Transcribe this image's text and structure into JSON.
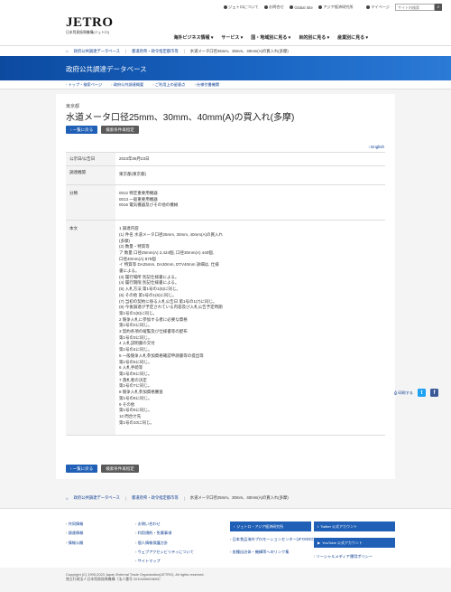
{
  "utility": {
    "about": "ジェトロについて",
    "contact": "お問合せ",
    "global": "Global Site",
    "ide": "アジア経済研究所",
    "mypage": "マイページ",
    "search_placeholder": "サイト内検索"
  },
  "logo": {
    "main": "JETRO",
    "sub": "日本貿易振興機構(ジェトロ)"
  },
  "gnav": [
    "海外ビジネス情報 ▾",
    "サービス ▾",
    "国・地域別に見る ▾",
    "目的別に見る ▾",
    "産業別に見る ▾"
  ],
  "breadcrumb": [
    "政府公共調達データベース",
    "都道府県・政令指定都市等",
    "水道メータ口径25mm、30mm、40mm(A)の買入れ(多摩)"
  ],
  "banner": {
    "title": "政府公共調達データベース"
  },
  "subnav": [
    "トップ・検索ページ",
    "政府公共調達概要",
    "ご利用上の留意点",
    "仕様付書機関"
  ],
  "main": {
    "prefecture": "東京都",
    "title": "水道メータ口径25mm、30mm、40mm(A)の買入れ(多摩)",
    "back_label": "一覧に戻る",
    "search_again_label": "検索条件再指定",
    "english_label": "English",
    "rows": [
      {
        "label": "公示日/公告日",
        "value": [
          "2023年08月23日"
        ]
      },
      {
        "label": "調達機関",
        "value": [
          "東京都(東京都)"
        ]
      },
      {
        "label": "分類",
        "value": [
          "0012 特定重要用機器",
          "0013 一般重要用機器",
          "0016 電気機器及びその他の機械"
        ]
      },
      {
        "label": "本文",
        "value": [
          "1 調達内容",
          "(1) 件名 水道メータ口径25mm, 30mm, 40mm(A)の買入れ",
          "(多摩)",
          "(2) 数量・特質等",
          "ア 数量 口径25mm(A) 2,424個, 口径30mm(A) 440個,",
          "口径40mm(A) 875個",
          "イ 特質等 DA25mm, DA30mm, DTV40mm 詳細は, 仕様",
          "書による。",
          "(3) 履行場所 別記仕様書による。",
          "(4) 履行期限 別記仕様書による。",
          "(5) 入札方法 第1号の1(5)に同じ。",
          "(6) その他 第1号の1(6)に同じ。",
          "(7) 当初の契約に係る入札公告日 第1号の1(7)に同じ。",
          "(8) 今後調達が予定されている内容及び入札公告予定時期",
          "第1号の1(8)に同じ。",
          "2 競争入札に参加する者に必要な資格",
          "第1号の2に同じ。",
          "3 契約条項の縦覧及び仕様書等の配布",
          "第1号の3に同じ。",
          "4 入札説明書の交付",
          "第1号の4に同じ。",
          "5 一般競争入札参加資格確認申請書等の提出等",
          "第1号の5に同じ。",
          "6 入札手続等",
          "第1号の6に同じ。",
          "7 落札者の決定",
          "第1号の7に同じ。",
          "8 競争入札参加資格審査",
          "第1号の8に同じ。",
          "9 その他",
          "第1号の9に同じ。",
          "10 問合せ先",
          "第1号の10に同じ。"
        ]
      }
    ],
    "print_label": "印刷する"
  },
  "footer": {
    "col1": [
      "共同情報",
      "調達情報",
      "情報公開"
    ],
    "col2": [
      "お問い合わせ",
      "利用規約・免責事項",
      "個人情報保護方針",
      "ウェブアクセシビリティについて",
      "サイトマップ"
    ],
    "box1": "ジェトロ・アジア経済研究所",
    "links3": [
      "日本食品海外プロモーションセンター(JFOODO)",
      "各種自治体・機構等へのリンク集"
    ],
    "twitter": "Twitter 公式アカウント",
    "youtube": "YouTube 公式アカウント",
    "social_policy": "ソーシャルメディア運用ポリシー",
    "copyright": "Copyright (C) 1995-2023 Japan External Trade Organization(JETRO). All rights reserved.",
    "corp": "独立行政法人日本貿易振興機構（法人番号 2010405003693）"
  },
  "colors": {
    "accent": "#1f5fb6",
    "twitter": "#1da1f2",
    "facebook": "#3b5998"
  }
}
